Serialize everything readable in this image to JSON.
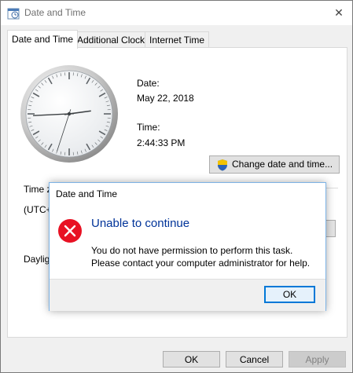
{
  "window": {
    "title": "Date and Time",
    "close_glyph": "✕"
  },
  "tabs": [
    {
      "label": "Date and Time",
      "active": true
    },
    {
      "label": "Additional Clocks",
      "active": false
    },
    {
      "label": "Internet Time",
      "active": false
    }
  ],
  "clock": {
    "time": "2:44:33 PM",
    "hour": 2,
    "minute": 44,
    "second": 33
  },
  "date_section": {
    "date_label": "Date:",
    "date_value": "May 22, 2018",
    "time_label": "Time:",
    "time_value": "2:44:33 PM",
    "change_button": "Change date and time...",
    "shield_icon": "uac-shield-icon"
  },
  "time_zone": {
    "heading_partial": "Time z",
    "value_partial": "(UTC+",
    "daylight_partial": "Dayligh"
  },
  "footer": {
    "ok": "OK",
    "cancel": "Cancel",
    "apply": "Apply"
  },
  "dialog": {
    "title": "Date and Time",
    "heading": "Unable to continue",
    "line1": "You do not have permission to perform this task.",
    "line2": "Please contact your computer administrator for help.",
    "ok": "OK",
    "icon": "error-icon",
    "accent_color": "#0078d7",
    "heading_color": "#003399",
    "error_color": "#e81123"
  }
}
